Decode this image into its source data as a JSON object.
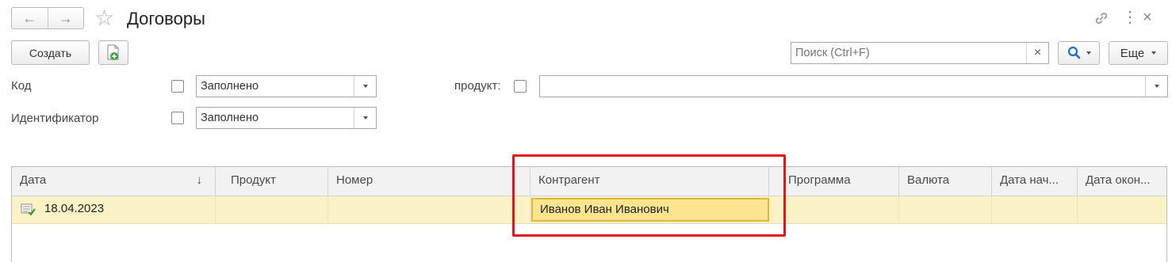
{
  "window": {
    "title": "Договоры",
    "nav": {
      "back_icon": "←",
      "forward_icon": "→"
    },
    "star_icon": "☆",
    "link_icon": "link-icon",
    "more_icon": "⋮",
    "close_icon": "×"
  },
  "toolbar": {
    "create_label": "Создать",
    "search_placeholder": "Поиск (Ctrl+F)",
    "search_clear_icon": "×",
    "more_label": "Еще"
  },
  "filters": {
    "code_label": "Код",
    "code_value": "Заполнено",
    "identifier_label": "Идентификатор",
    "identifier_value": "Заполнено",
    "product_label": "продукт:",
    "product_value": ""
  },
  "table": {
    "sort_icon": "↓",
    "columns": [
      "Дата",
      "Продукт",
      "Номер",
      "Контрагент",
      "Программа",
      "Валюта",
      "Дата нач...",
      "Дата окон..."
    ],
    "rows": [
      {
        "date": "18.04.2023",
        "product": "",
        "number": "",
        "counterparty": "Иванов Иван Иванович",
        "program": "",
        "currency": "",
        "start_date": "",
        "end_date": ""
      }
    ]
  },
  "colors": {
    "accent_blue": "#1f6bd0",
    "selected_row": "#fbf2c8",
    "highlight_box": "#e5141a",
    "current_cell_border": "#e2b53c"
  }
}
